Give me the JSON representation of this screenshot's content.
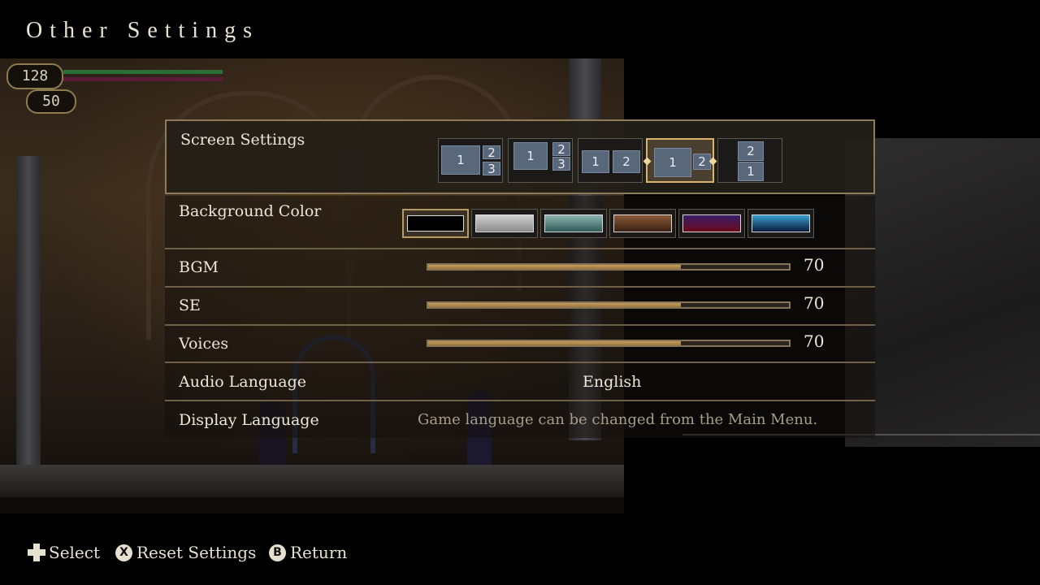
{
  "page": {
    "title": "Other Settings"
  },
  "hud": {
    "hp": "128",
    "mp": "50",
    "hp_fraction": 1.0,
    "mp_fraction": 1.0
  },
  "settings": {
    "screen": {
      "label": "Screen Settings",
      "selected_index": 3,
      "options": [
        {
          "name": "layout-1-23-stacked",
          "boxes": [
            "1",
            "2",
            "3"
          ]
        },
        {
          "name": "layout-1-23-offset",
          "boxes": [
            "1",
            "2",
            "3"
          ]
        },
        {
          "name": "layout-1-2",
          "boxes": [
            "1",
            "2"
          ]
        },
        {
          "name": "layout-1-2-wide",
          "boxes": [
            "1",
            "2"
          ]
        },
        {
          "name": "layout-2-over-1",
          "boxes": [
            "2",
            "1"
          ]
        }
      ]
    },
    "background_color": {
      "label": "Background Color",
      "selected_index": 0,
      "colors": [
        {
          "name": "black",
          "gradient": [
            "#000000",
            "#000000"
          ]
        },
        {
          "name": "gray",
          "gradient": [
            "#d0d0d0",
            "#8a8a8a"
          ]
        },
        {
          "name": "teal",
          "gradient": [
            "#8fb5b0",
            "#2e5a57"
          ]
        },
        {
          "name": "brown",
          "gradient": [
            "#8a5a3a",
            "#3a1e12"
          ]
        },
        {
          "name": "purple-red",
          "gradient": [
            "#3a1e6a",
            "#6a0a1a"
          ]
        },
        {
          "name": "blue",
          "gradient": [
            "#3aa0d0",
            "#0a1a3a"
          ]
        }
      ]
    },
    "bgm": {
      "label": "BGM",
      "value": "70",
      "fraction": 0.7
    },
    "se": {
      "label": "SE",
      "value": "70",
      "fraction": 0.7
    },
    "voices": {
      "label": "Voices",
      "value": "70",
      "fraction": 0.7
    },
    "audio_language": {
      "label": "Audio Language",
      "value": "English"
    },
    "display_language": {
      "label": "Display Language",
      "note": "Game language can be changed from the Main Menu."
    }
  },
  "footer": {
    "select": {
      "label": "Select",
      "icon": "dpad-icon"
    },
    "reset": {
      "label": "Reset Settings",
      "button": "X"
    },
    "return": {
      "label": "Return",
      "button": "B"
    }
  },
  "colors": {
    "accent": "#d9b46a",
    "slider_fill": "#b58a4e",
    "divider": "#6f6048"
  }
}
